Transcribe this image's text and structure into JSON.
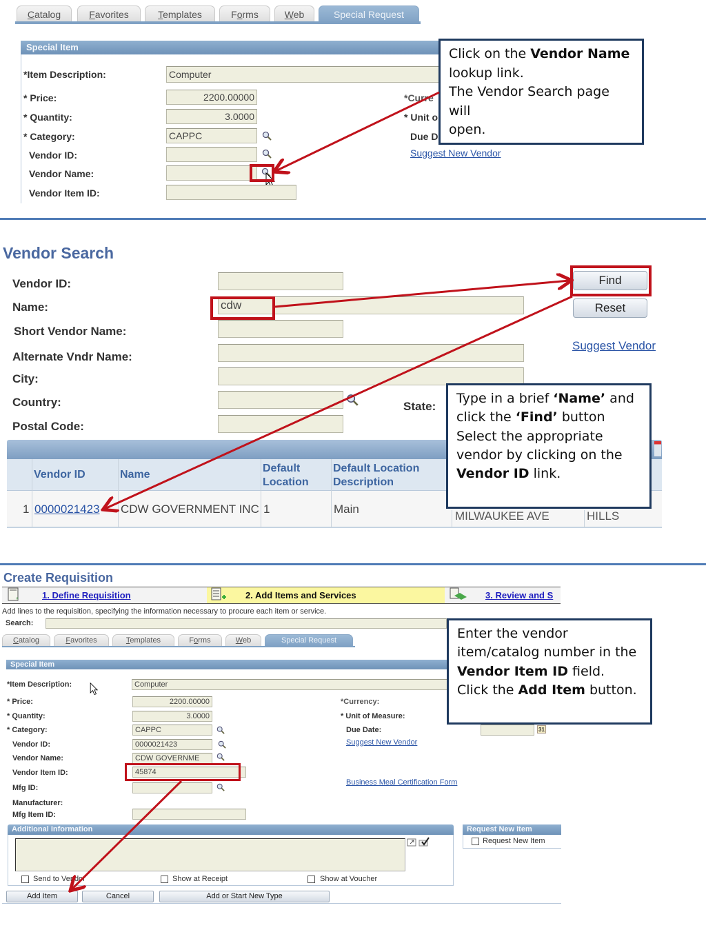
{
  "panel1": {
    "tabs": [
      {
        "label": "Catalog",
        "accel": "C",
        "rest": "atalog"
      },
      {
        "label": "Favorites",
        "accel": "F",
        "rest": "avorites"
      },
      {
        "label": "Templates",
        "accel": "T",
        "rest": "emplates"
      },
      {
        "label": "Forms",
        "pre": "F",
        "accel": "o",
        "rest": "rms"
      },
      {
        "label": "Web",
        "accel": "W",
        "rest": "eb"
      },
      {
        "label": "Special Request"
      }
    ],
    "group_title": "Special Item",
    "labels": {
      "item_description": "*Item Description:",
      "price": "* Price:",
      "quantity": "* Quantity:",
      "category": "* Category:",
      "vendor_id": "Vendor ID:",
      "vendor_name": "Vendor Name:",
      "vendor_item_id": "Vendor Item ID:",
      "currency": "*Curre",
      "unit": "* Unit o",
      "due": "Due D"
    },
    "values": {
      "item_description": "Computer",
      "price": "2200.00000",
      "quantity": "3.0000",
      "category": "CAPPC",
      "vendor_id": "",
      "vendor_name": "",
      "vendor_item_id": ""
    },
    "suggest_link": "Suggest New Vendor",
    "callout": {
      "line1_pre": "Click on the ",
      "line1_bold": "Vendor Name",
      "line2": "lookup link.",
      "line3": "The Vendor Search page will",
      "line4": "open."
    }
  },
  "panel2": {
    "title": "Vendor Search",
    "labels": {
      "vendor_id": "Vendor ID:",
      "name": "Name:",
      "short_name": "Short Vendor Name:",
      "alt_name": "Alternate Vndr Name:",
      "city": "City:",
      "country": "Country:",
      "state": "State:",
      "postal": "Postal Code:"
    },
    "values": {
      "vendor_id": "",
      "name": "cdw",
      "short_name": "",
      "alt_name": "",
      "city": "",
      "country": "",
      "postal": ""
    },
    "buttons": {
      "find": "Find",
      "reset": "Reset"
    },
    "suggest_link": "Suggest Vendor",
    "table": {
      "headers": [
        "Vendor ID",
        "Name",
        "Default Location",
        "Default Location Description"
      ],
      "header_lines": {
        "default_location": [
          "Default",
          "Location"
        ],
        "default_location_desc": [
          "Default Location",
          "Description"
        ]
      },
      "rows": [
        {
          "num": "1",
          "vendor_id": "0000021423",
          "name": "CDW GOVERNMENT INC",
          "location": "1",
          "description": "Main",
          "address": "MILWAUKEE AVE",
          "city": "HILLS"
        }
      ]
    },
    "callout": {
      "l1_pre": "Type in a brief ",
      "l1_bold": "‘Name’",
      "l1_post": " and",
      "l2_pre": "click the ",
      "l2_bold": "‘Find’",
      "l2_post": " button",
      "l3": "Select the appropriate",
      "l4": "vendor by clicking on the",
      "l5_bold": "Vendor ID",
      "l5_post": " link."
    }
  },
  "panel3": {
    "title": "Create Requisition",
    "steps": [
      {
        "label": "1. Define Requisition",
        "state": "link"
      },
      {
        "label": "2. Add Items and Services",
        "state": "current"
      },
      {
        "label": "3. Review and S",
        "state": "link"
      }
    ],
    "instructions": "Add lines to the requisition, specifying the information necessary to procure each item or service.",
    "search_label": "Search:",
    "search_value": "",
    "tabs": [
      {
        "label": "Catalog",
        "accel": "C",
        "rest": "atalog"
      },
      {
        "label": "Favorites",
        "accel": "F",
        "rest": "avorites"
      },
      {
        "label": "Templates",
        "accel": "T",
        "rest": "emplates"
      },
      {
        "label": "Forms",
        "pre": "F",
        "accel": "o",
        "rest": "rms"
      },
      {
        "label": "Web",
        "accel": "W",
        "rest": "eb"
      },
      {
        "label": "Special Request"
      }
    ],
    "group_title": "Special Item",
    "labels": {
      "item_description": "*Item Description:",
      "price": "* Price:",
      "quantity": "* Quantity:",
      "category": "* Category:",
      "vendor_id": "Vendor ID:",
      "vendor_name": "Vendor Name:",
      "vendor_item_id": "Vendor Item ID:",
      "mfg_id": "Mfg ID:",
      "manufacturer": "Manufacturer:",
      "mfg_item_id": "Mfg Item ID:",
      "currency": "*Currency:",
      "unit": "* Unit of Measure:",
      "due": "Due Date:"
    },
    "values": {
      "item_description": "Computer",
      "price": "2200.00000",
      "quantity": "3.0000",
      "category": "CAPPC",
      "vendor_id": "0000021423",
      "vendor_name": "CDW GOVERNME",
      "vendor_item_id": "45874",
      "mfg_id": "",
      "mfg_item_id": "",
      "due_date": ""
    },
    "calendar_icon_text": "31",
    "suggest_link": "Suggest New Vendor",
    "meal_link": "Business Meal Certification Form",
    "additional_info": {
      "title": "Additional Information",
      "comment": "",
      "checkboxes": [
        "Send to Vendor",
        "Show at Receipt",
        "Show at Voucher"
      ]
    },
    "request_new_item": {
      "title": "Request New Item",
      "checkbox": "Request New Item"
    },
    "buttons": {
      "add_item": "Add Item",
      "cancel": "Cancel",
      "add_or_start": "Add or Start New Type"
    },
    "callout": {
      "l1": "Enter the vendor",
      "l2": "item/catalog number in the",
      "l3_bold": "Vendor Item ID",
      "l3_post": " field.",
      "l4_pre": "Click the ",
      "l4_bold": "Add Item",
      "l4_post": " button."
    }
  },
  "colors": {
    "annotation_red": "#c0121b",
    "header_blue": "#4f7bb6",
    "link_blue": "#2a54a6",
    "callout_border": "#1f3a5f",
    "field_bg": "#efefdf",
    "step_highlight": "#fbf7a0"
  }
}
